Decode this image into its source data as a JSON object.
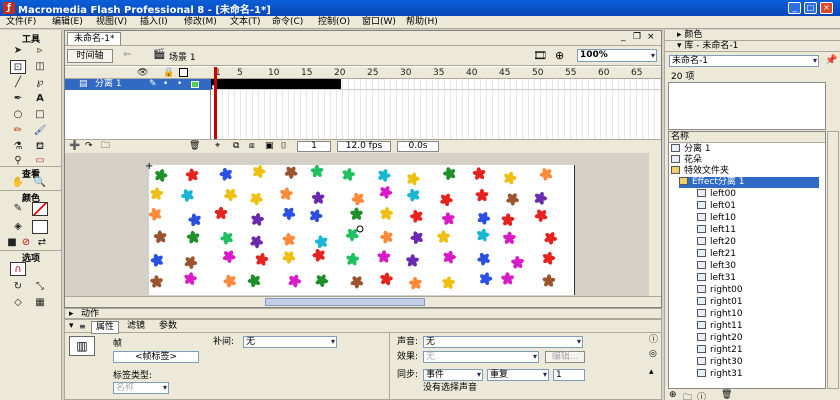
{
  "window": {
    "title": "Macromedia Flash Professional 8 - [未命名-1*]",
    "app_icon": "f-logo-icon"
  },
  "menu": [
    "文件(F)",
    "编辑(E)",
    "视图(V)",
    "插入(I)",
    "修改(M)",
    "文本(T)",
    "命令(C)",
    "控制(O)",
    "窗口(W)",
    "帮助(H)"
  ],
  "tools": {
    "title": "工具",
    "view_label": "查看",
    "colors_label": "颜色",
    "options_label": "选项"
  },
  "document": {
    "tab": "未命名-1*",
    "timeline_button": "时间轴",
    "scene": "场景 1",
    "zoom": "100%",
    "timeline": {
      "frame_numbers": [
        "1",
        "5",
        "10",
        "15",
        "20",
        "25",
        "30",
        "35",
        "40",
        "45",
        "50",
        "55",
        "60",
        "65"
      ],
      "layer_name": "分离 1",
      "current_frame": "1",
      "fps": "12.0 fps",
      "time": "0.0s"
    }
  },
  "stage": {
    "flower_colors": [
      "#e6221e",
      "#1f8f2a",
      "#2b4fe0",
      "#d81bc8",
      "#f0c010",
      "#9a5530",
      "#19b6d4",
      "#ff8a3a",
      "#6a2ab0",
      "#20c060"
    ]
  },
  "actions_panel": {
    "label": "动作"
  },
  "properties": {
    "tabs": [
      "属性",
      "滤镜",
      "参数"
    ],
    "frame_label": "帧",
    "frame_name_placeholder": "<帧标签>",
    "tween_label": "补间:",
    "tween_value": "无",
    "label_type_label": "标签类型:",
    "label_type_value": "名称",
    "sound_label": "声音:",
    "sound_value": "无",
    "effect_label": "效果:",
    "effect_value": "无",
    "edit_button": "编辑...",
    "sync_label": "同步:",
    "sync_value": "事件",
    "repeat_value": "重复",
    "repeat_count": "1",
    "no_sound": "没有选择声音"
  },
  "right": {
    "colors_header": "颜色",
    "library_header": "库 - 未命名-1",
    "library_select": "未命名-1",
    "item_count": "20 项",
    "name_column": "名称",
    "items": [
      "分离 1",
      "花朵",
      "特效文件夹",
      "Effect分离 1",
      "left00",
      "left01",
      "left10",
      "left11",
      "left20",
      "left21",
      "left30",
      "left31",
      "right00",
      "right01",
      "right10",
      "right11",
      "right20",
      "right21",
      "right30",
      "right31"
    ]
  }
}
